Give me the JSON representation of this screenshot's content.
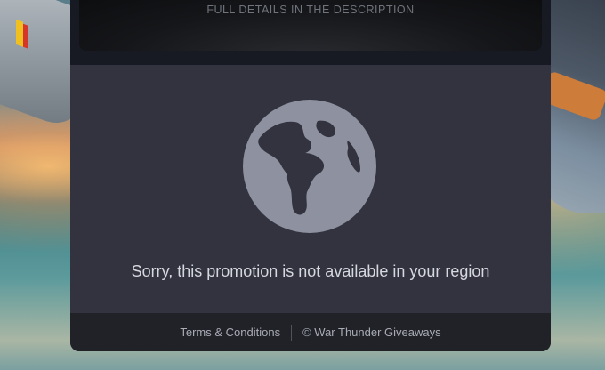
{
  "promo": {
    "caption": "FULL DETAILS IN THE DESCRIPTION"
  },
  "notice": {
    "icon": "globe-icon",
    "message": "Sorry, this promotion is not available in your region"
  },
  "footer": {
    "terms_label": "Terms & Conditions",
    "copyright_label": "© War Thunder Giveaways"
  },
  "colors": {
    "panel": "#32333f",
    "footer": "#202228",
    "icon": "#8e91a0"
  }
}
